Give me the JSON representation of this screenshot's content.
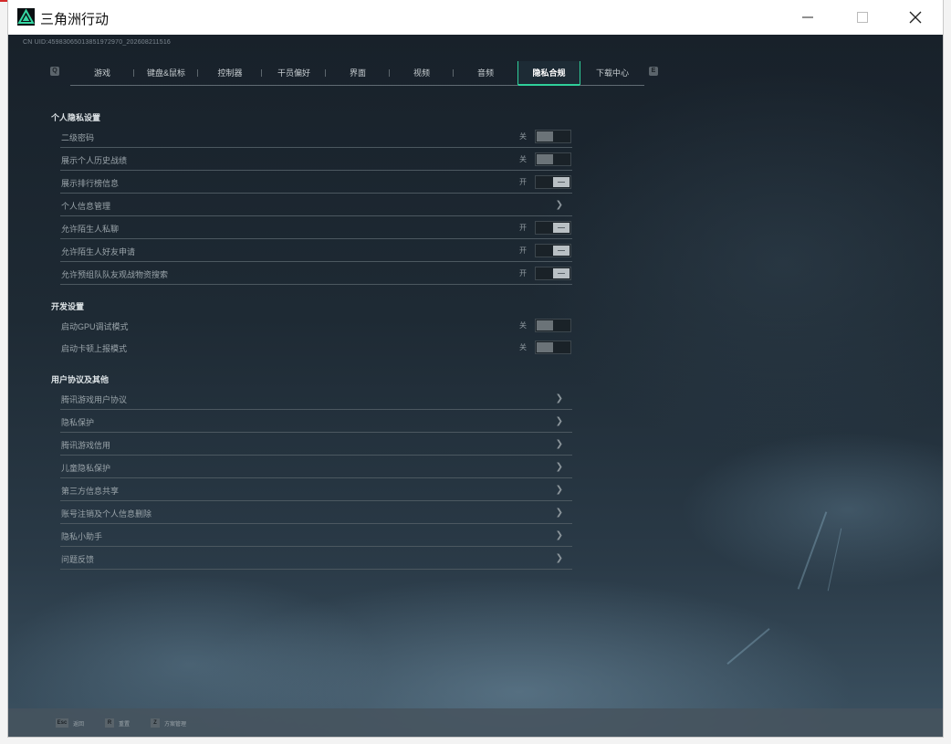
{
  "window": {
    "title": "三角洲行动"
  },
  "uid_line": "CN UID:45983065013851972970_202608211516",
  "tabs": {
    "prev_key": "Q",
    "next_key": "E",
    "items": [
      {
        "label": "游戏"
      },
      {
        "label": "键盘&鼠标"
      },
      {
        "label": "控制器"
      },
      {
        "label": "干员偏好"
      },
      {
        "label": "界面"
      },
      {
        "label": "视频"
      },
      {
        "label": "音频"
      },
      {
        "label": "隐私合规",
        "active": true
      },
      {
        "label": "下载中心"
      }
    ]
  },
  "sections": {
    "personal": {
      "title": "个人隐私设置",
      "rows": [
        {
          "label": "二级密码",
          "state": "关",
          "on": false
        },
        {
          "label": "展示个人历史战绩",
          "state": "关",
          "on": false
        },
        {
          "label": "展示排行榜信息",
          "state": "开",
          "on": true
        },
        {
          "label": "个人信息管理"
        },
        {
          "label": "允许陌生人私聊",
          "state": "开",
          "on": true
        },
        {
          "label": "允许陌生人好友申请",
          "state": "开",
          "on": true
        },
        {
          "label": "允许预组队队友观战物资搜索",
          "state": "开",
          "on": true
        }
      ]
    },
    "dev": {
      "title": "开发设置",
      "rows": [
        {
          "label": "启动GPU调试模式",
          "state": "关",
          "on": false
        },
        {
          "label": "启动卡顿上报模式",
          "state": "关",
          "on": false
        }
      ]
    },
    "agreements": {
      "title": "用户协议及其他",
      "rows": [
        {
          "label": "腾讯游戏用户协议"
        },
        {
          "label": "隐私保护"
        },
        {
          "label": "腾讯游戏信用"
        },
        {
          "label": "儿童隐私保护"
        },
        {
          "label": "第三方信息共享"
        },
        {
          "label": "账号注销及个人信息删除"
        },
        {
          "label": "隐私小助手"
        },
        {
          "label": "问题反馈"
        }
      ]
    }
  },
  "bottom_hints": [
    {
      "key": "Esc",
      "label": "返回"
    },
    {
      "key": "R",
      "label": "重置"
    },
    {
      "key": "Z",
      "label": "方案管理"
    }
  ],
  "colors": {
    "accent": "#2fcf9a"
  }
}
